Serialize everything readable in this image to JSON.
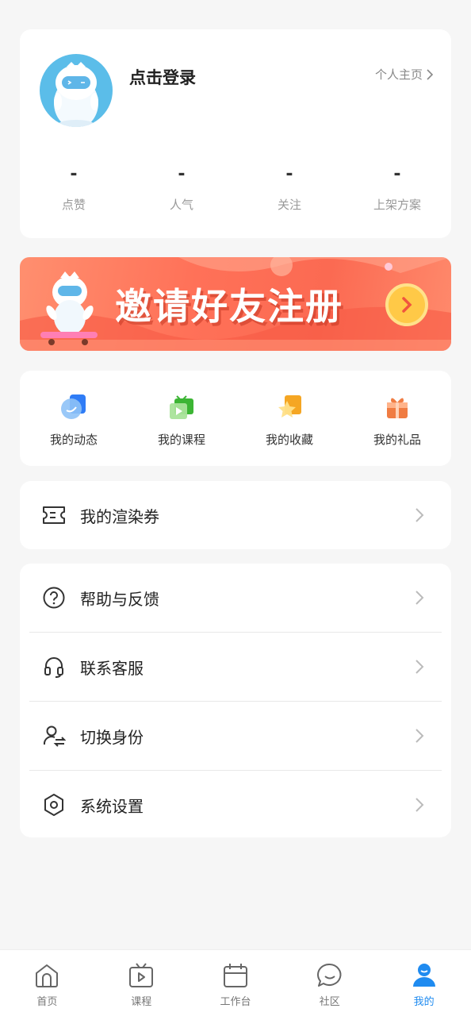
{
  "profile": {
    "login_text": "点击登录",
    "homepage_link": "个人主页",
    "stats": [
      {
        "value": "-",
        "label": "点赞"
      },
      {
        "value": "-",
        "label": "人气"
      },
      {
        "value": "-",
        "label": "关注"
      },
      {
        "value": "-",
        "label": "上架方案"
      }
    ]
  },
  "banner": {
    "text": "邀请好友注册"
  },
  "quick_menu": [
    {
      "label": "我的动态",
      "icon": "moments-icon"
    },
    {
      "label": "我的课程",
      "icon": "course-tv-icon"
    },
    {
      "label": "我的收藏",
      "icon": "favorite-star-icon"
    },
    {
      "label": "我的礼品",
      "icon": "gift-icon"
    }
  ],
  "vouchers": {
    "label": "我的渲染券",
    "icon": "ticket-icon"
  },
  "settings_list": [
    {
      "label": "帮助与反馈",
      "icon": "help-icon"
    },
    {
      "label": "联系客服",
      "icon": "headset-icon"
    },
    {
      "label": "切换身份",
      "icon": "switch-user-icon"
    },
    {
      "label": "系统设置",
      "icon": "settings-hexagon-icon"
    }
  ],
  "tabbar": [
    {
      "label": "首页",
      "icon": "home-icon"
    },
    {
      "label": "课程",
      "icon": "course-icon"
    },
    {
      "label": "工作台",
      "icon": "calendar-icon"
    },
    {
      "label": "社区",
      "icon": "chat-icon"
    },
    {
      "label": "我的",
      "icon": "user-icon",
      "active": true
    }
  ],
  "colors": {
    "accent": "#1f8bf0",
    "background": "#f6f6f6",
    "banner": "#ff7158"
  }
}
